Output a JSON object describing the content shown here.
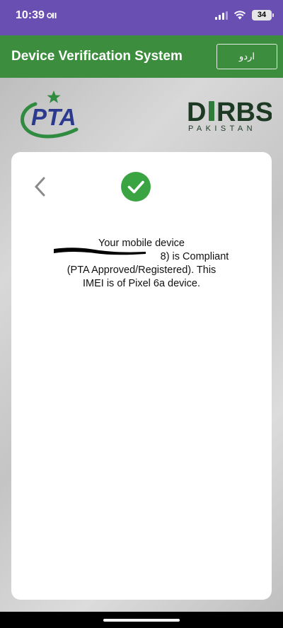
{
  "status_bar": {
    "time": "10:39",
    "battery_level": "34",
    "icons": [
      "location-icon",
      "signal-icon",
      "wifi-icon",
      "battery-icon"
    ]
  },
  "app_bar": {
    "title": "Device Verification System",
    "language_button": "اردو",
    "color": "#3c8d3e"
  },
  "logos": {
    "pta": {
      "text": "PTA"
    },
    "dirbs": {
      "word_prefix": "D",
      "word_suffix": "RBS",
      "subtitle": "PAKISTAN"
    }
  },
  "result": {
    "status_icon": "check-icon",
    "status_color": "#3aa442",
    "message_line1": "Your mobile device",
    "message_line2": "8) is Compliant",
    "message_line3": "(PTA Approved/Registered). This",
    "message_line4": "IMEI is of Pixel 6a device."
  },
  "colors": {
    "status_bar": "#6a4fb3",
    "pta_blue": "#2b3a8f",
    "pta_green": "#2e8b3f",
    "dirbs_dark": "#1d3a24"
  }
}
